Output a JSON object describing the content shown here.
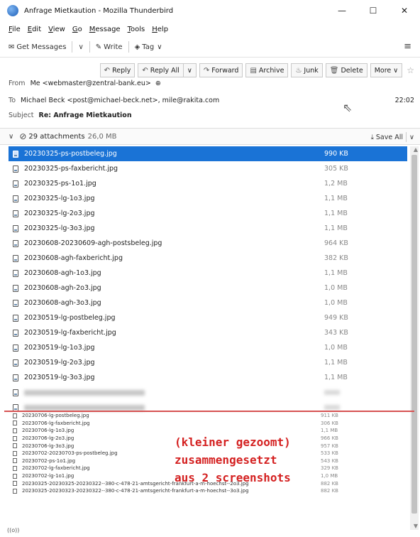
{
  "window": {
    "title": "Anfrage Mietkaution - Mozilla Thunderbird",
    "controls": [
      "—",
      "☐",
      "✕"
    ]
  },
  "menu": [
    "File",
    "Edit",
    "View",
    "Go",
    "Message",
    "Tools",
    "Help"
  ],
  "toolbar": {
    "get_messages": "Get Messages",
    "write": "Write",
    "tag": "Tag"
  },
  "actions": {
    "reply": "Reply",
    "reply_all": "Reply All",
    "forward": "Forward",
    "archive": "Archive",
    "junk": "Junk",
    "delete": "Delete",
    "more": "More"
  },
  "header": {
    "from_label": "From",
    "from_value": "Me <webmaster@zentral-bank.eu>",
    "to_label": "To",
    "to_value": "Michael Beck <post@michael-beck.net>, mile@rakita.com",
    "time": "22:02",
    "subject_label": "Subject",
    "subject_value": "Re: Anfrage Mietkaution"
  },
  "attachments": {
    "summary": "29 attachments",
    "total_size": "26,0 MB",
    "save_all": "Save All"
  },
  "list_top": [
    {
      "name": "20230325-ps-postbeleg.jpg",
      "size": "990 KB",
      "selected": true
    },
    {
      "name": "20230325-ps-faxbericht.jpg",
      "size": "305 KB"
    },
    {
      "name": "20230325-ps-1o1.jpg",
      "size": "1,2 MB"
    },
    {
      "name": "20230325-lg-1o3.jpg",
      "size": "1,1 MB"
    },
    {
      "name": "20230325-lg-2o3.jpg",
      "size": "1,1 MB"
    },
    {
      "name": "20230325-lg-3o3.jpg",
      "size": "1,1 MB"
    },
    {
      "name": "20230608-20230609-agh-postsbeleg.jpg",
      "size": "964 KB"
    },
    {
      "name": "20230608-agh-faxbericht.jpg",
      "size": "382 KB"
    },
    {
      "name": "20230608-agh-1o3.jpg",
      "size": "1,1 MB"
    },
    {
      "name": "20230608-agh-2o3.jpg",
      "size": "1,0 MB"
    },
    {
      "name": "20230608-agh-3o3.jpg",
      "size": "1,0 MB"
    },
    {
      "name": "20230519-lg-postbeleg.jpg",
      "size": "949 KB"
    },
    {
      "name": "20230519-lg-faxbericht.jpg",
      "size": "343 KB"
    },
    {
      "name": "20230519-lg-1o3.jpg",
      "size": "1,0 MB"
    },
    {
      "name": "20230519-lg-2o3.jpg",
      "size": "1,1 MB"
    },
    {
      "name": "20230519-lg-3o3.jpg",
      "size": "1,1 MB"
    }
  ],
  "list_bottom": [
    {
      "name": "20230706-lg-postbeleg.jpg",
      "size": "911 KB"
    },
    {
      "name": "20230706-lg-faxbericht.jpg",
      "size": "306 KB"
    },
    {
      "name": "20230706-lg-1o3.jpg",
      "size": "1,1 MB"
    },
    {
      "name": "20230706-lg-2o3.jpg",
      "size": "966 KB"
    },
    {
      "name": "20230706-lg-3o3.jpg",
      "size": "957 KB"
    },
    {
      "name": "20230702-20230703-ps-postbeleg.jpg",
      "size": "533 KB"
    },
    {
      "name": "20230702-ps-1o1.jpg",
      "size": "543 KB"
    },
    {
      "name": "20230702-lg-faxbericht.jpg",
      "size": "329 KB"
    },
    {
      "name": "20230702-lg-1o1.jpg",
      "size": "1,0 MB"
    },
    {
      "name": "20230325-20230325-20230322--380-c-478-21-amtsgericht-frankfurt-a-m-hoechst--2o3.jpg",
      "size": "882 KB"
    },
    {
      "name": "20230325-20230323-20230322--380-c-478-21-amtsgericht-frankfurt-a-m-hoechst--3o3.jpg",
      "size": "882 KB"
    }
  ],
  "annotation": [
    "(kleiner gezoomt)",
    "zusammengesetzt",
    "aus 2 screenshots"
  ],
  "bottom_status": "((o))"
}
